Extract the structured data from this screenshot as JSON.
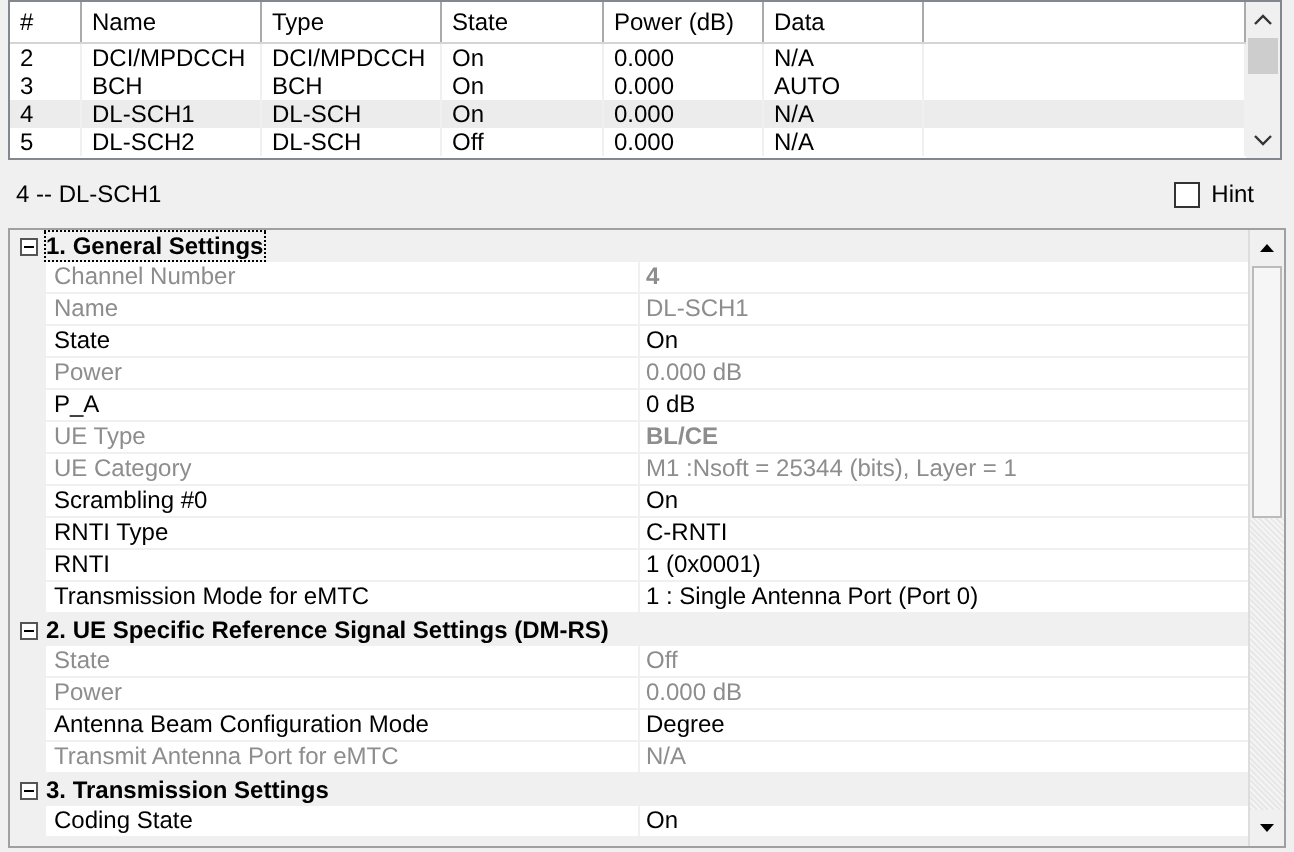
{
  "channel_table": {
    "columns": [
      "#",
      "Name",
      "Type",
      "State",
      "Power (dB)",
      "Data"
    ],
    "rows": [
      {
        "cells": [
          "2",
          "DCI/MPDCCH",
          "DCI/MPDCCH",
          "On",
          "0.000",
          "N/A"
        ],
        "selected": false
      },
      {
        "cells": [
          "3",
          "BCH",
          "BCH",
          "On",
          "0.000",
          "AUTO"
        ],
        "selected": false
      },
      {
        "cells": [
          "4",
          "DL-SCH1",
          "DL-SCH",
          "On",
          "0.000",
          "N/A"
        ],
        "selected": true
      },
      {
        "cells": [
          "5",
          "DL-SCH2",
          "DL-SCH",
          "Off",
          "0.000",
          "N/A"
        ],
        "selected": false
      }
    ]
  },
  "selection_label": "4 -- DL-SCH1",
  "hint": {
    "label": "Hint",
    "checked": false
  },
  "property_grid": {
    "categories": [
      {
        "title": "1. General Settings",
        "expanded": true,
        "focused": true,
        "properties": [
          {
            "name": "Channel Number",
            "value": "4",
            "disabled": true,
            "bold": true
          },
          {
            "name": "Name",
            "value": "DL-SCH1",
            "disabled": true,
            "bold": false
          },
          {
            "name": "State",
            "value": "On",
            "disabled": false,
            "bold": false
          },
          {
            "name": "Power",
            "value": "0.000 dB",
            "disabled": true,
            "bold": false
          },
          {
            "name": "P_A",
            "value": "0 dB",
            "disabled": false,
            "bold": false
          },
          {
            "name": "UE Type",
            "value": "BL/CE",
            "disabled": true,
            "bold": true
          },
          {
            "name": "UE Category",
            "value": "M1 :Nsoft = 25344 (bits), Layer = 1",
            "disabled": true,
            "bold": false
          },
          {
            "name": "Scrambling #0",
            "value": "On",
            "disabled": false,
            "bold": false
          },
          {
            "name": "RNTI Type",
            "value": "C-RNTI",
            "disabled": false,
            "bold": false
          },
          {
            "name": "RNTI",
            "value": "1 (0x0001)",
            "disabled": false,
            "bold": false
          },
          {
            "name": "Transmission Mode for eMTC",
            "value": "1 : Single Antenna Port (Port 0)",
            "disabled": false,
            "bold": false
          }
        ]
      },
      {
        "title": "2. UE Specific Reference Signal Settings (DM-RS)",
        "expanded": true,
        "focused": false,
        "properties": [
          {
            "name": "State",
            "value": "Off",
            "disabled": true,
            "bold": false
          },
          {
            "name": "Power",
            "value": "0.000 dB",
            "disabled": true,
            "bold": false
          },
          {
            "name": "Antenna Beam Configuration Mode",
            "value": "Degree",
            "disabled": false,
            "bold": false
          },
          {
            "name": "Transmit Antenna Port for eMTC",
            "value": "N/A",
            "disabled": true,
            "bold": false
          }
        ]
      },
      {
        "title": "3. Transmission Settings",
        "expanded": true,
        "focused": false,
        "properties": [
          {
            "name": "Coding State",
            "value": "On",
            "disabled": false,
            "bold": false
          }
        ]
      }
    ]
  }
}
